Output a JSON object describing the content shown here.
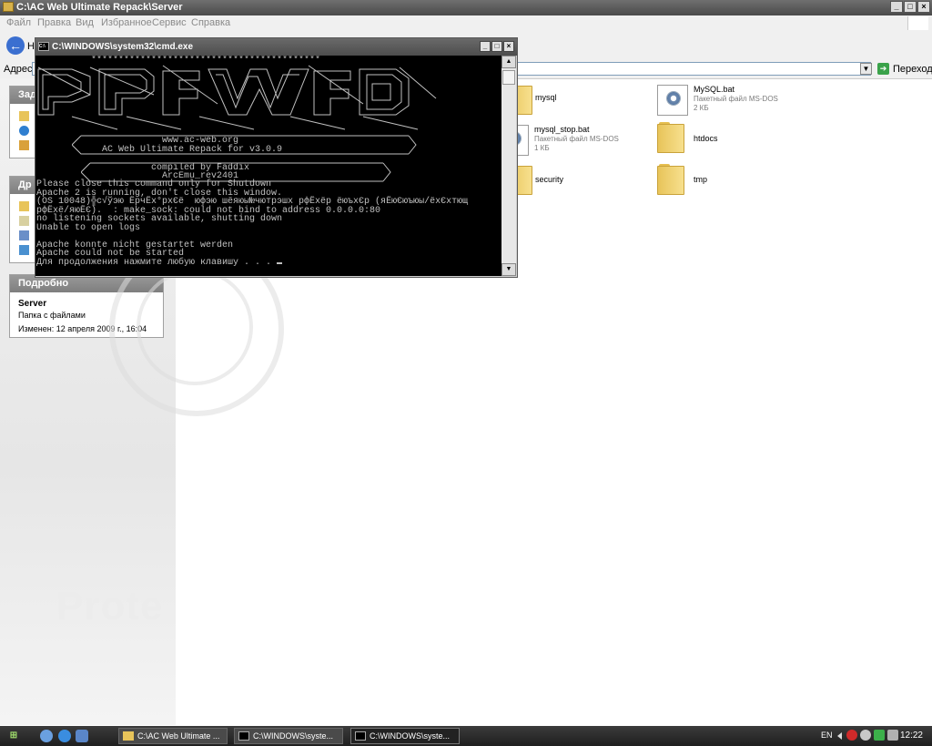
{
  "explorer": {
    "title": "C:\\AC Web Ultimate Repack\\Server",
    "menu": [
      "Файл",
      "Правка",
      "Вид",
      "Избранное",
      "Сервис",
      "Справка"
    ],
    "back_label": "Н",
    "address_label": "Адрес:",
    "go_label": "Переход",
    "left_panels": {
      "tasks_header": "Зад",
      "other_header": "Др",
      "details_header": "Подробно",
      "details_name": "Server",
      "details_type": "Папка с файлами",
      "details_modified": "Изменен: 12 апреля 2009 г., 16:04"
    },
    "files": [
      {
        "name": "mysql",
        "type": "",
        "size": "",
        "kind": "folder"
      },
      {
        "name": "MySQL.bat",
        "type": "Пакетный файл MS-DOS",
        "size": "2 КБ",
        "kind": "bat"
      },
      {
        "name": "mysql_stop.bat",
        "type": "Пакетный файл MS-DOS",
        "size": "1 КБ",
        "kind": "bat"
      },
      {
        "name": "htdocs",
        "type": "",
        "size": "",
        "kind": "folder"
      },
      {
        "name": "security",
        "type": "",
        "size": "",
        "kind": "folder"
      },
      {
        "name": "tmp",
        "type": "",
        "size": "",
        "kind": "folder"
      }
    ],
    "watermark": "Prote"
  },
  "cmd": {
    "title": "C:\\WINDOWS\\system32\\cmd.exe",
    "lines": [
      "          ******************************************",
      "                       www.ac-web.org",
      "            AC Web Ultimate Repack for v3.0.9",
      "                     compiled by Faddix",
      "                       ArcEmu_rev2401",
      "Please close this command only for Shutdown",
      "Apache 2 is running, don't close this window.",
      "(OS 10048)╬с√ўэю ЁрчЁх°рхЄё  юфэю шёяюы№чютрэшх рфЁхёр ёюъхЄр (яЁюЄюъюы/ёхЄхтющ",
      "рфЁхё/яюЁЄ).  : make_sock: could not bind to address 0.0.0.0:80",
      "no listening sockets available, shutting down",
      "Unable to open logs",
      "",
      "Apache konnte nicht gestartet werden",
      "Apache could not be started",
      "Для продолжения нажмите любую клавишу . . . "
    ]
  },
  "taskbar": {
    "tasks": [
      "C:\\AC Web Ultimate ...",
      "C:\\WINDOWS\\syste...",
      "C:\\WINDOWS\\syste..."
    ],
    "language": "EN",
    "clock": "12:22"
  }
}
